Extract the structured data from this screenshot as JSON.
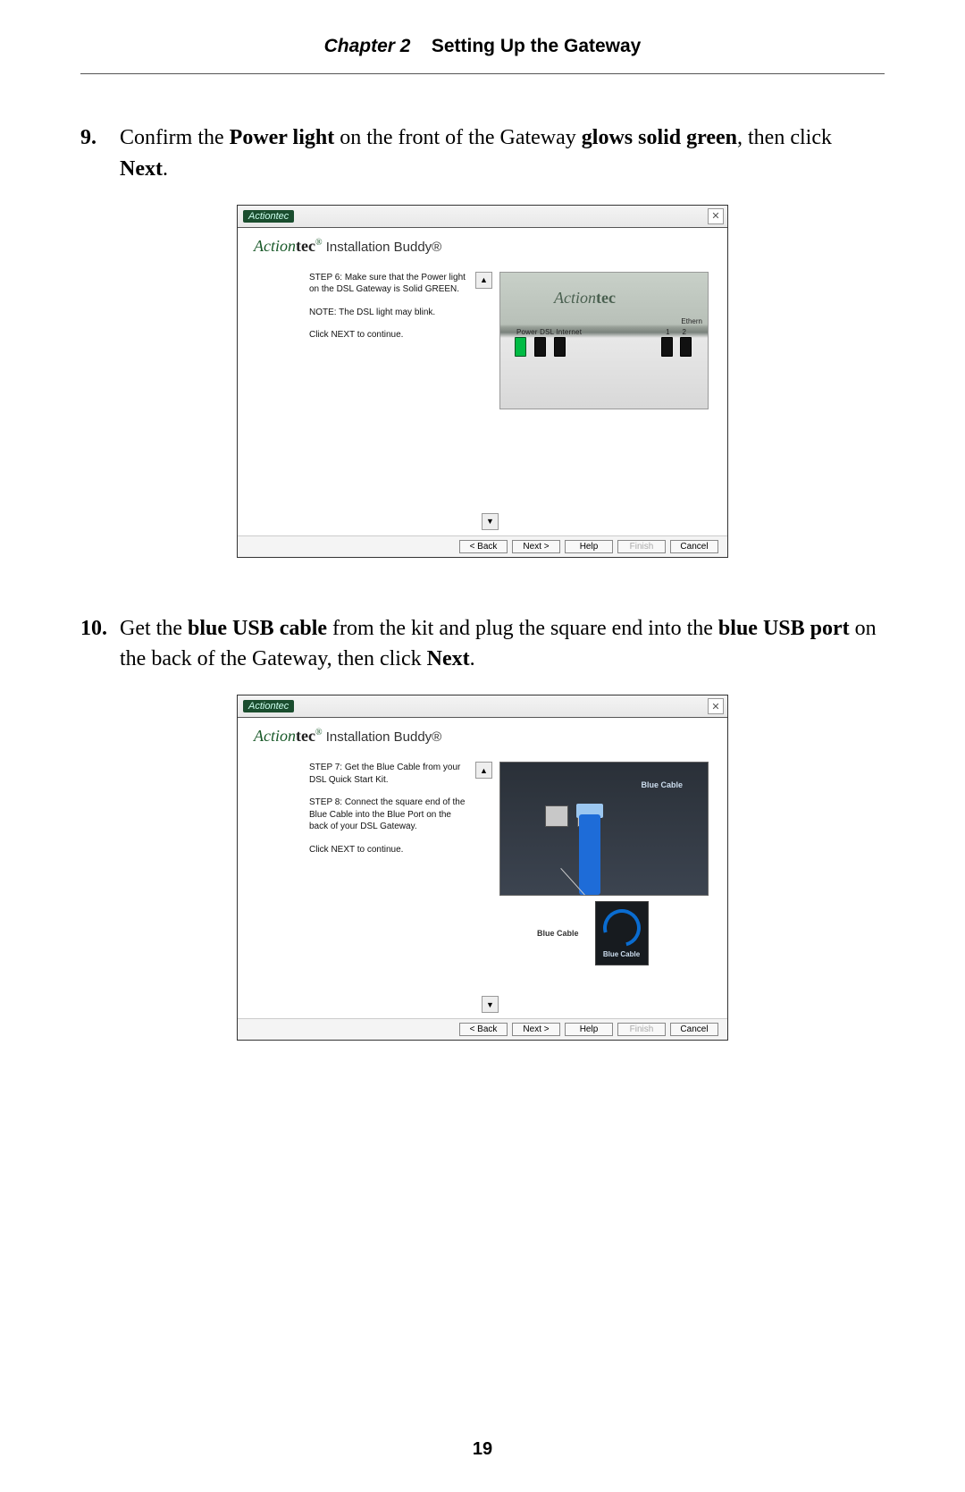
{
  "header": {
    "chapter": "Chapter 2",
    "title": "Setting Up the Gateway"
  },
  "steps": [
    {
      "num": "9.",
      "parts": [
        {
          "t": "Confirm the ",
          "b": false
        },
        {
          "t": "Power light",
          "b": true
        },
        {
          "t": " on the front of the Gateway ",
          "b": false
        },
        {
          "t": "glows solid green",
          "b": true
        },
        {
          "t": ", then click ",
          "b": false
        },
        {
          "t": "Next",
          "b": true
        },
        {
          "t": ".",
          "b": false
        }
      ]
    },
    {
      "num": "10.",
      "parts": [
        {
          "t": "Get the ",
          "b": false
        },
        {
          "t": "blue USB cable",
          "b": true
        },
        {
          "t": " from the kit and plug the square end into the ",
          "b": false
        },
        {
          "t": "blue USB port",
          "b": true
        },
        {
          "t": " on the back of the Gateway, then click ",
          "b": false
        },
        {
          "t": "Next",
          "b": true
        },
        {
          "t": ".",
          "b": false
        }
      ]
    }
  ],
  "dialog1": {
    "tag": "Actiontec",
    "brand_action": "Action",
    "brand_tec": "tec",
    "brand_reg": "®",
    "brand_ib": " Installation Buddy®",
    "text1": "STEP 6:  Make sure that the Power light on the DSL Gateway is Solid GREEN.",
    "text2": "NOTE: The DSL light may blink.",
    "text3": "Click NEXT to continue.",
    "photo_logo_action": "Action",
    "photo_logo_tec": "tec",
    "photo_label_row": "Power  DSL  Internet",
    "photo_ethernet": "Ethern",
    "photo_num1": "1",
    "photo_num2": "2",
    "buttons": {
      "back": "< Back",
      "next": "Next >",
      "help": "Help",
      "finish": "Finish",
      "cancel": "Cancel"
    }
  },
  "dialog2": {
    "tag": "Actiontec",
    "brand_action": "Action",
    "brand_tec": "tec",
    "brand_reg": "®",
    "brand_ib": " Installation Buddy®",
    "text1": "STEP 7:  Get the Blue Cable from your DSL Quick Start Kit.",
    "text2": "STEP 8:  Connect the square end of the Blue Cable into the Blue Port on the back of your DSL Gateway.",
    "text3": "Click NEXT to continue.",
    "photo_blue_label": "Blue Cable",
    "photo_bc_bottom": "Blue Cable",
    "photo_bc_loop": "Blue Cable",
    "buttons": {
      "back": "< Back",
      "next": "Next >",
      "help": "Help",
      "finish": "Finish",
      "cancel": "Cancel"
    }
  },
  "page_number": "19"
}
